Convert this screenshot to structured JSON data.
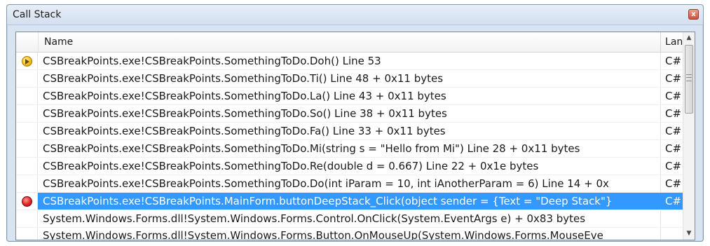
{
  "window": {
    "title": "Call Stack",
    "close_label": "x"
  },
  "header": {
    "name_label": "Name",
    "lang_label": "Lang"
  },
  "rows": [
    {
      "name": "CSBreakPoints.exe!CSBreakPoints.SomethingToDo.Doh() Line 53",
      "lang": "C#",
      "icon": "current-statement-arrow-icon"
    },
    {
      "name": "CSBreakPoints.exe!CSBreakPoints.SomethingToDo.Ti() Line 48 + 0x11 bytes",
      "lang": "C#",
      "icon": ""
    },
    {
      "name": "CSBreakPoints.exe!CSBreakPoints.SomethingToDo.La() Line 43 + 0x11 bytes",
      "lang": "C#",
      "icon": ""
    },
    {
      "name": "CSBreakPoints.exe!CSBreakPoints.SomethingToDo.So() Line 38 + 0x11 bytes",
      "lang": "C#",
      "icon": ""
    },
    {
      "name": "CSBreakPoints.exe!CSBreakPoints.SomethingToDo.Fa() Line 33 + 0x11 bytes",
      "lang": "C#",
      "icon": ""
    },
    {
      "name": "CSBreakPoints.exe!CSBreakPoints.SomethingToDo.Mi(string s = \"Hello from Mi\") Line 28 + 0x11 bytes",
      "lang": "C#",
      "icon": ""
    },
    {
      "name": "CSBreakPoints.exe!CSBreakPoints.SomethingToDo.Re(double d = 0.667) Line 22 + 0x1e bytes",
      "lang": "C#",
      "icon": ""
    },
    {
      "name": "CSBreakPoints.exe!CSBreakPoints.SomethingToDo.Do(int iParam = 10, int iAnotherParam = 6) Line 14 + 0x",
      "lang": "C#",
      "icon": ""
    },
    {
      "name": "CSBreakPoints.exe!CSBreakPoints.MainForm.buttonDeepStack_Click(object sender = {Text = \"Deep Stack\"}",
      "lang": "C#",
      "icon": "breakpoint-icon",
      "selected": true
    },
    {
      "name": "System.Windows.Forms.dll!System.Windows.Forms.Control.OnClick(System.EventArgs e) + 0x83 bytes",
      "lang": "",
      "icon": ""
    },
    {
      "name": "System.Windows.Forms.dll!System.Windows.Forms.Button.OnMouseUp(System.Windows.Forms.MouseEve",
      "lang": "",
      "icon": ""
    }
  ],
  "colors": {
    "selection": "#3399ff",
    "breakpoint": "#e02020",
    "current_statement": "#f2c019"
  }
}
